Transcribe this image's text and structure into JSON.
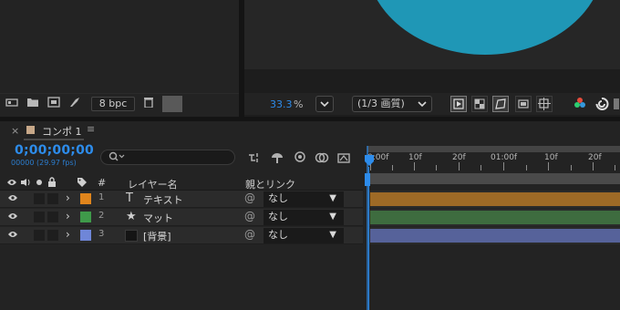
{
  "project_panel": {
    "bpc_label": "8 bpc"
  },
  "viewer": {
    "zoom_value": "33.3",
    "zoom_unit": "%",
    "resolution": "(1/3 画質)"
  },
  "timeline": {
    "tab_close": "×",
    "tab_label": "コンポ 1",
    "tab_menu": "≡",
    "timecode": "0;00;00;00",
    "frames": "00000 (29.97 fps)",
    "search_placeholder": "",
    "columns": {
      "hash": "#",
      "layer_name": "レイヤー名",
      "parent_link": "親とリンク"
    },
    "ruler_labels": [
      "0:00f",
      "10f",
      "20f",
      "01:00f",
      "10f",
      "20f"
    ],
    "layers": [
      {
        "num": "1",
        "type_glyph": "T",
        "name": "テキスト",
        "parent": "なし",
        "label_color": "#e0851c",
        "bar_color": "#9e6a26"
      },
      {
        "num": "2",
        "type_glyph": "★",
        "name": "マット",
        "parent": "なし",
        "label_color": "#3f9a4a",
        "bar_color": "#3e6c3f"
      },
      {
        "num": "3",
        "type_glyph": "",
        "name": "[背景]",
        "parent": "なし",
        "label_color": "#6f86d8",
        "bar_color": "#56629a"
      }
    ]
  },
  "colors": {
    "accent_blue": "#2d8ceb",
    "comp_shape": "#1f97b6"
  }
}
